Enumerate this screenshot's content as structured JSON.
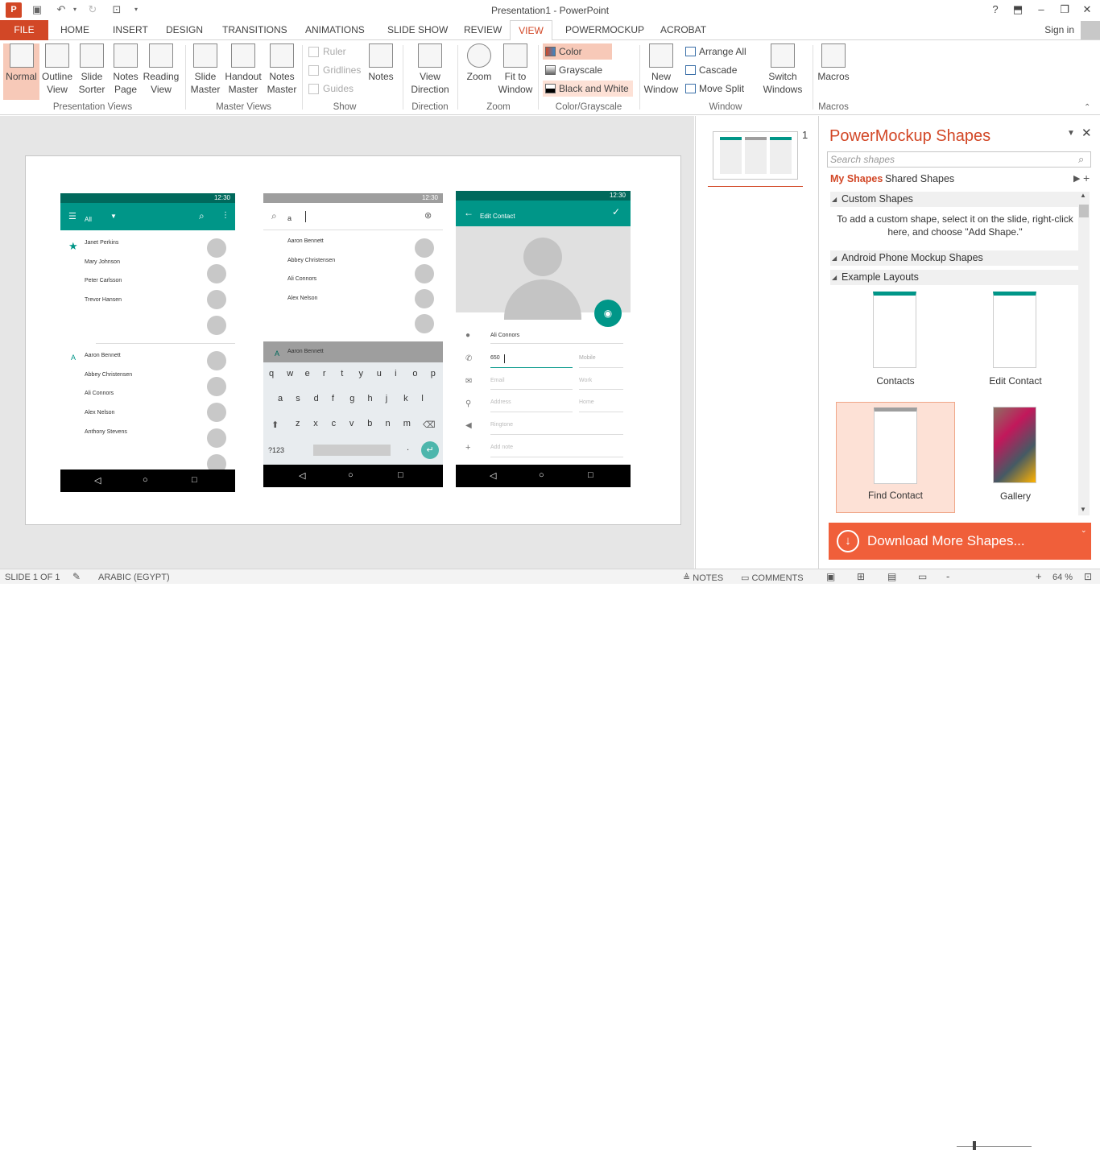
{
  "window": {
    "title": "Presentation1 - PowerPoint",
    "help": "?",
    "app_badge": "P"
  },
  "tabs": {
    "file": "FILE",
    "items": [
      "HOME",
      "INSERT",
      "DESIGN",
      "TRANSITIONS",
      "ANIMATIONS",
      "SLIDE SHOW",
      "REVIEW",
      "VIEW",
      "POWERMOCKUP",
      "ACROBAT"
    ],
    "active": "VIEW",
    "sign_in": "Sign in"
  },
  "ribbon": {
    "presentation_views": {
      "group": "Presentation Views",
      "items": [
        {
          "l1": "Normal",
          "l2": ""
        },
        {
          "l1": "Outline",
          "l2": "View"
        },
        {
          "l1": "Slide",
          "l2": "Sorter"
        },
        {
          "l1": "Notes",
          "l2": "Page"
        },
        {
          "l1": "Reading",
          "l2": "View"
        }
      ]
    },
    "master_views": {
      "group": "Master Views",
      "items": [
        {
          "l1": "Slide",
          "l2": "Master"
        },
        {
          "l1": "Handout",
          "l2": "Master"
        },
        {
          "l1": "Notes",
          "l2": "Master"
        }
      ]
    },
    "show": {
      "group": "Show",
      "ruler": "Ruler",
      "gridlines": "Gridlines",
      "guides": "Guides",
      "notes": "Notes"
    },
    "direction": {
      "group": "Direction",
      "l1": "View",
      "l2": "Direction"
    },
    "zoom": {
      "group": "Zoom",
      "zoom": "Zoom",
      "fit_l1": "Fit to",
      "fit_l2": "Window"
    },
    "color": {
      "group": "Color/Grayscale",
      "color": "Color",
      "grayscale": "Grayscale",
      "bw": "Black and White"
    },
    "window": {
      "group": "Window",
      "new_l1": "New",
      "new_l2": "Window",
      "arrange": "Arrange All",
      "cascade": "Cascade",
      "split": "Move Split",
      "switch_l1": "Switch",
      "switch_l2": "Windows"
    },
    "macros": {
      "group": "Macros",
      "label": "Macros"
    }
  },
  "slide_number": "1",
  "phone1": {
    "time": "12:30",
    "filter": "All",
    "contacts_a": [
      "Janet Perkins",
      "Mary Johnson",
      "Peter Carlsson",
      "Trevor Hansen"
    ],
    "letter": "A",
    "contacts_b": [
      "Aaron Bennett",
      "Abbey Christensen",
      "Ali Connors",
      "Alex Nelson",
      "Anthony Stevens"
    ]
  },
  "phone2": {
    "time": "12:30",
    "query": "a",
    "results": [
      "Aaron Bennett",
      "Abbey Christensen",
      "Ali Connors",
      "Alex Nelson"
    ],
    "highlight": "Aaron Bennett",
    "letter": "A",
    "row1": [
      "q",
      "w",
      "e",
      "r",
      "t",
      "y",
      "u",
      "i",
      "o",
      "p"
    ],
    "row2": [
      "a",
      "s",
      "d",
      "f",
      "g",
      "h",
      "j",
      "k",
      "l"
    ],
    "row3": [
      "z",
      "x",
      "c",
      "v",
      "b",
      "n",
      "m"
    ],
    "sym": "?123",
    "period": "."
  },
  "phone3": {
    "time": "12:30",
    "title": "Edit Contact",
    "name": "Ali Connors",
    "phone": "650",
    "phone_type": "Mobile",
    "email": "Email",
    "email_type": "Work",
    "address": "Address",
    "address_type": "Home",
    "ringtone": "Ringtone",
    "note": "Add note"
  },
  "pm": {
    "title": "PowerMockup Shapes",
    "search_placeholder": "Search shapes",
    "tab_my": "My Shapes",
    "tab_shared": "Shared Shapes",
    "sec_custom": "Custom Shapes",
    "custom_hint": "To add a custom shape, select it on the slide, right-click here, and choose \"Add Shape.\"",
    "sec_android": "Android Phone Mockup Shapes",
    "sec_examples": "Example Layouts",
    "tiles": [
      "Contacts",
      "Edit Contact",
      "Find Contact",
      "Gallery"
    ],
    "download": "Download More Shapes..."
  },
  "status": {
    "slide": "SLIDE 1 OF 1",
    "language": "ARABIC (EGYPT)",
    "notes": "NOTES",
    "comments": "COMMENTS",
    "zoom": "64 %",
    "minus": "-",
    "plus": "+"
  },
  "colors": {
    "accent": "#d24726",
    "teal": "#009688",
    "orange": "#f05f3a"
  }
}
